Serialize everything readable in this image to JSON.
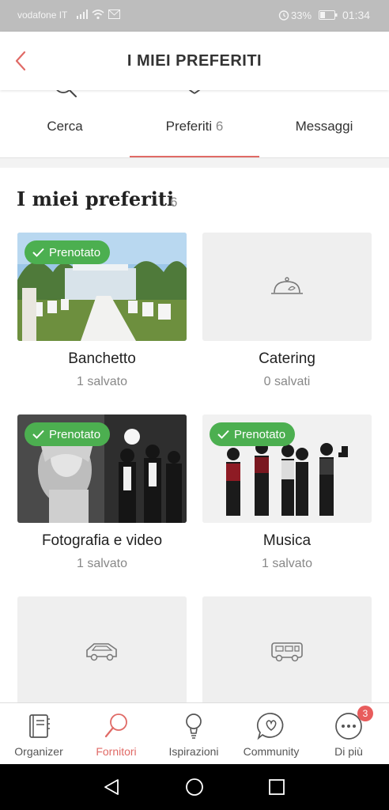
{
  "status_bar": {
    "carrier": "vodafone IT",
    "battery": "33%",
    "time": "01:34"
  },
  "header": {
    "title": "I MIEI PREFERITI"
  },
  "tabs": [
    {
      "label": "Cerca",
      "count": "",
      "icon": "search-icon"
    },
    {
      "label": "Preferiti",
      "count": "6",
      "icon": "heart-icon",
      "active": true
    },
    {
      "label": "Messaggi",
      "count": "",
      "icon": "mail-icon"
    }
  ],
  "section": {
    "title": "I miei preferiti",
    "count": "6"
  },
  "badge_label": "Prenotato",
  "cards": [
    {
      "name": "Banchetto",
      "saved": "1 salvato",
      "booked": true
    },
    {
      "name": "Catering",
      "saved": "0 salvati",
      "booked": false,
      "icon": "cloche-icon"
    },
    {
      "name": "Fotografia e video",
      "saved": "1 salvato",
      "booked": true
    },
    {
      "name": "Musica",
      "saved": "1 salvato",
      "booked": true
    },
    {
      "name": "",
      "saved": "",
      "booked": false,
      "icon": "car-icon"
    },
    {
      "name": "",
      "saved": "",
      "booked": false,
      "icon": "bus-icon"
    }
  ],
  "bottom_nav": [
    {
      "label": "Organizer",
      "icon": "notebook-icon"
    },
    {
      "label": "Fornitori",
      "icon": "magnifier-icon",
      "active": true
    },
    {
      "label": "Ispirazioni",
      "icon": "lightbulb-icon"
    },
    {
      "label": "Community",
      "icon": "chat-heart-icon"
    },
    {
      "label": "Di più",
      "icon": "more-icon",
      "badge": "3"
    }
  ],
  "colors": {
    "accent": "#e06a66",
    "booked_badge": "#4caf50",
    "status_bar": "#bdbdbd",
    "placeholder": "#efefef"
  }
}
